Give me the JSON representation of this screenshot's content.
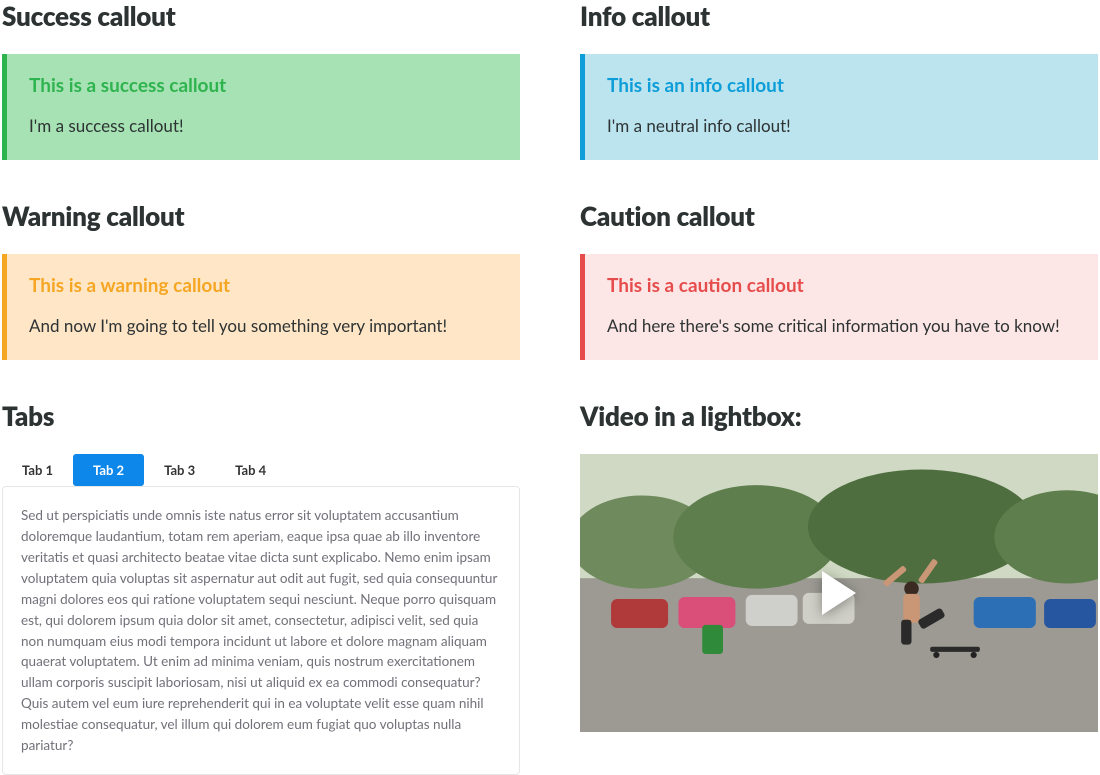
{
  "sections": {
    "success": {
      "heading": "Success callout",
      "title": "This is a success callout",
      "body": "I'm a success callout!"
    },
    "info": {
      "heading": "Info callout",
      "title": "This is an info callout",
      "body": "I'm a neutral info callout!"
    },
    "warning": {
      "heading": "Warning  callout",
      "title": "This is a warning callout",
      "body": "And now I'm going to tell you something very important!"
    },
    "caution": {
      "heading": "Caution callout",
      "title": "This is a caution callout",
      "body": "And here there's some critical information you have to know!"
    },
    "tabs": {
      "heading": "Tabs",
      "items": [
        {
          "label": "Tab 1",
          "active": false
        },
        {
          "label": "Tab 2",
          "active": true
        },
        {
          "label": "Tab 3",
          "active": false
        },
        {
          "label": "Tab 4",
          "active": false
        }
      ],
      "panel": "Sed ut perspiciatis unde omnis iste natus error sit voluptatem accusantium doloremque laudantium, totam rem aperiam, eaque ipsa quae ab illo inventore veritatis et quasi architecto beatae vitae dicta sunt explicabo. Nemo enim ipsam voluptatem quia voluptas sit aspernatur aut odit aut fugit, sed quia consequuntur magni dolores eos qui ratione voluptatem sequi nesciunt. Neque porro quisquam est, qui dolorem ipsum quia dolor sit amet, consectetur, adipisci velit, sed quia non numquam eius modi tempora incidunt ut labore et dolore magnam aliquam quaerat voluptatem. Ut enim ad minima veniam, quis nostrum exercitationem ullam corporis suscipit laboriosam, nisi ut aliquid ex ea commodi consequatur? Quis autem vel eum iure reprehenderit qui in ea voluptate velit esse quam nihil molestiae consequatur, vel illum qui dolorem eum fugiat quo voluptas nulla pariatur?"
    },
    "video": {
      "heading": "Video in a lightbox:"
    }
  },
  "colors": {
    "success": "#2fb34e",
    "info": "#0d9dd8",
    "warning": "#f5a623",
    "caution": "#e74c4c",
    "tab_active": "#0d87e9"
  }
}
